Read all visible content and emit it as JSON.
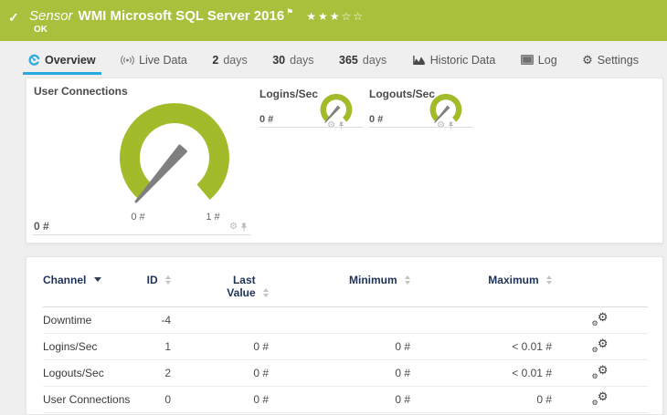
{
  "colors": {
    "header_green": "#a8c03c",
    "gauge_green": "#a2bb2b",
    "accent_blue": "#29a9e0",
    "table_header_navy": "#1e3158",
    "page_background": "#efefef"
  },
  "header": {
    "check": "✓",
    "kind": "Sensor",
    "title": "WMI Microsoft SQL Server 2016",
    "flag": "⚑",
    "stars": "★★★☆☆",
    "status": "OK"
  },
  "tabs": {
    "overview": "Overview",
    "live_data": "Live Data",
    "d2_num": "2",
    "d2_unit": "days",
    "d30_num": "30",
    "d30_unit": "days",
    "d365_num": "365",
    "d365_unit": "days",
    "historic": "Historic Data",
    "log": "Log",
    "settings": "Settings",
    "settings_gear": "⚙"
  },
  "gauges": {
    "gear": "⚙",
    "main": {
      "title": "User Connections",
      "value": "0 #",
      "scale_min": "0 #",
      "scale_max": "1 #"
    },
    "logins": {
      "title": "Logins/Sec",
      "value": "0 #"
    },
    "logouts": {
      "title": "Logouts/Sec",
      "value": "0 #"
    }
  },
  "table": {
    "headers": {
      "channel": "Channel",
      "id": "ID",
      "last_value": "Last Value",
      "minimum": "Minimum",
      "maximum": "Maximum"
    },
    "row_gear": "⚙",
    "rows": [
      {
        "channel": "Downtime",
        "id": "-4",
        "last": "",
        "min": "",
        "max": ""
      },
      {
        "channel": "Logins/Sec",
        "id": "1",
        "last": "0 #",
        "min": "0 #",
        "max": "< 0.01 #"
      },
      {
        "channel": "Logouts/Sec",
        "id": "2",
        "last": "0 #",
        "min": "0 #",
        "max": "< 0.01 #"
      },
      {
        "channel": "User Connections",
        "id": "0",
        "last": "0 #",
        "min": "0 #",
        "max": "0 #"
      }
    ]
  }
}
